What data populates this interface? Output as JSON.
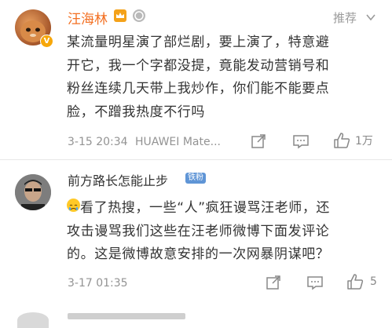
{
  "post1": {
    "author": "汪海林",
    "recommend_label": "推荐",
    "lines": [
      "某流量明星演了部烂剧，要上演了，特意避",
      "开它，我一个字都没提，竟能发动营销号和",
      "粉丝连续几天带上我炒作，你们能不能要点",
      "脸，不蹭我热度不行吗"
    ],
    "timestamp": "3-15 20:34",
    "device": "HUAWEI Mate...",
    "like_count": "1万",
    "colors": {
      "name": "#f36f21"
    }
  },
  "post2": {
    "author": "前方路长怎能止步",
    "fan_badge": "铁粉",
    "lines": [
      "看了热搜，一些“人”疯狂谩骂汪老师，还",
      "攻击谩骂我们这些在汪老师微博下面发评论",
      "的。这是微博故意安排的一次网暴阴谋吧？"
    ],
    "timestamp": "3-17 01:35",
    "like_count": "5",
    "colors": {
      "name": "#333333",
      "badge": "#5f95d6"
    }
  },
  "icons": {
    "share": "share-icon",
    "comment": "comment-icon",
    "like": "thumbs-up-icon",
    "more": "chevron-down-icon",
    "crying": "crying-emoji-icon"
  }
}
